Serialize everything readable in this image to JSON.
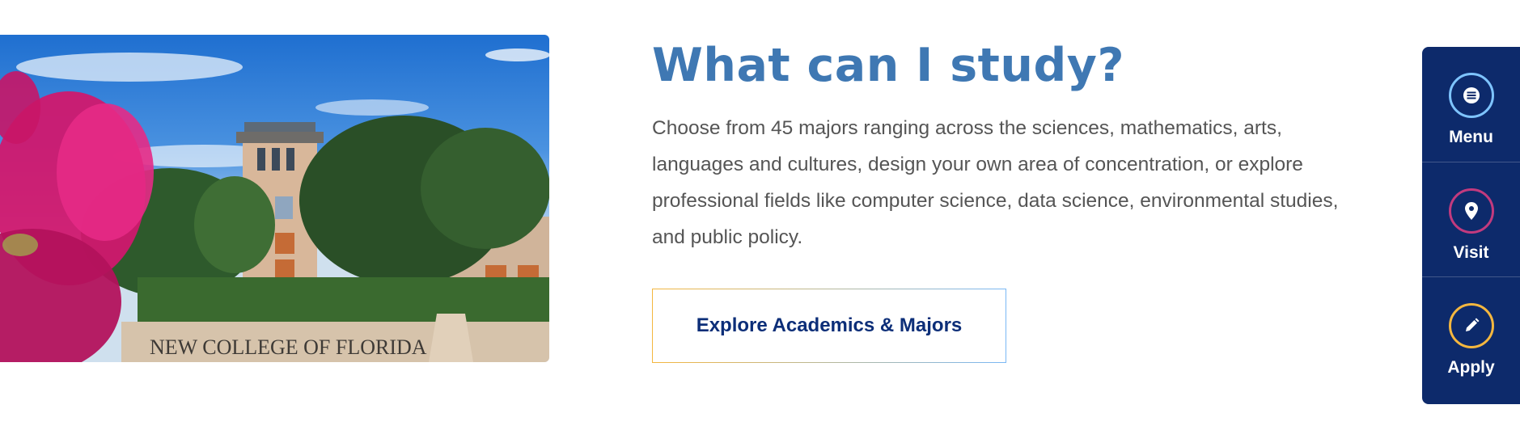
{
  "hero": {
    "image_alt": "Campus building with palm trees and pink flower in foreground",
    "sign_text": "NEW COLLEGE OF FLORIDA"
  },
  "content": {
    "heading": "What can I study?",
    "body": "Choose from 45 majors ranging across the sciences, mathematics, arts, languages and cultures, design your own area of concentration, or explore professional fields like computer science, data science, environmental studies, and public policy.",
    "cta_label": "Explore Academics & Majors"
  },
  "rail": {
    "items": [
      {
        "label": "Menu",
        "icon": "menu-icon",
        "ring_color": "#7ec4ff"
      },
      {
        "label": "Visit",
        "icon": "map-pin-icon",
        "ring_color": "#c23a7e"
      },
      {
        "label": "Apply",
        "icon": "pencil-icon",
        "ring_color": "#f4b73f"
      }
    ]
  },
  "colors": {
    "heading": "#3f78b3",
    "body_text": "#555555",
    "cta_text": "#0c2e78",
    "rail_bg": "#0d2a6b"
  }
}
